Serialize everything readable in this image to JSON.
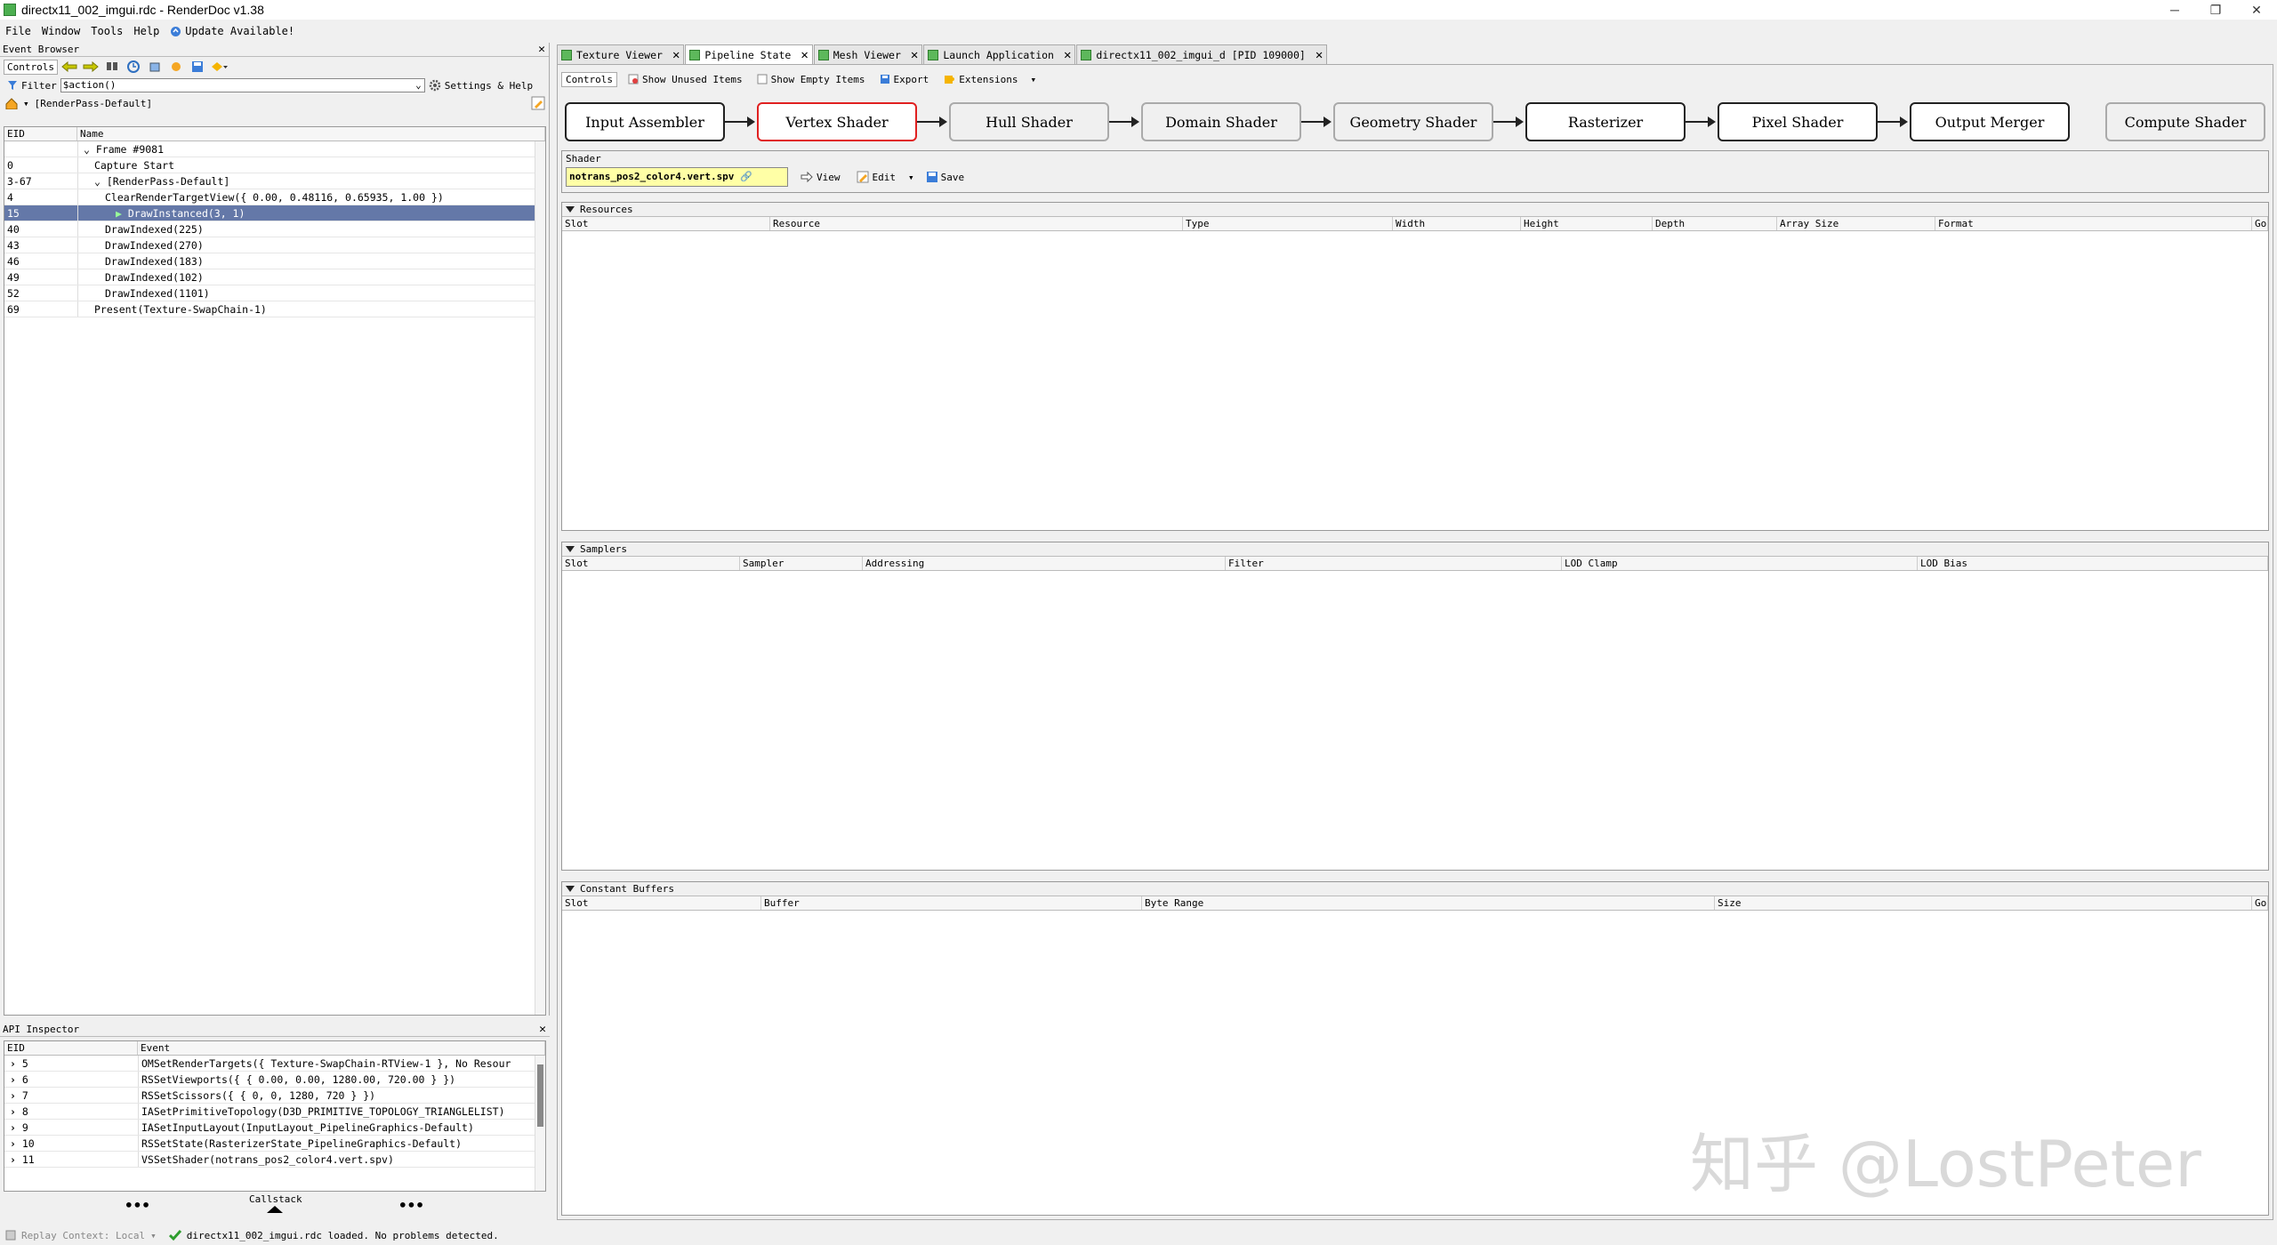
{
  "window": {
    "title": "directx11_002_imgui.rdc - RenderDoc v1.38",
    "min": "─",
    "restore": "❐",
    "close": "✕"
  },
  "menu": {
    "file": "File",
    "window": "Window",
    "tools": "Tools",
    "help": "Help",
    "update": "Update Available!"
  },
  "event_browser": {
    "title": "Event Browser",
    "controls_label": "Controls",
    "filter_label": "Filter",
    "filter_value": "$action()",
    "settings_label": "Settings & Help",
    "breadcrumb": "[RenderPass-Default]",
    "columns": [
      "EID",
      "Name"
    ],
    "rows": [
      {
        "eid": "",
        "name": "Frame #9081",
        "indent": 0,
        "expand": true
      },
      {
        "eid": "0",
        "name": "Capture Start",
        "indent": 1
      },
      {
        "eid": "3-67",
        "name": "[RenderPass-Default]",
        "indent": 1,
        "expand": true
      },
      {
        "eid": "4",
        "name": "ClearRenderTargetView({ 0.00, 0.48116, 0.65935, 1.00 })",
        "indent": 2
      },
      {
        "eid": "15",
        "name": "DrawInstanced(3, 1)",
        "indent": 3,
        "selected": true
      },
      {
        "eid": "40",
        "name": "DrawIndexed(225)",
        "indent": 2
      },
      {
        "eid": "43",
        "name": "DrawIndexed(270)",
        "indent": 2
      },
      {
        "eid": "46",
        "name": "DrawIndexed(183)",
        "indent": 2
      },
      {
        "eid": "49",
        "name": "DrawIndexed(102)",
        "indent": 2
      },
      {
        "eid": "52",
        "name": "DrawIndexed(1101)",
        "indent": 2
      },
      {
        "eid": "69",
        "name": "Present(Texture-SwapChain-1)",
        "indent": 1
      }
    ]
  },
  "api_inspector": {
    "title": "API Inspector",
    "columns": [
      "EID",
      "Event"
    ],
    "rows": [
      {
        "eid": "5",
        "event": "OMSetRenderTargets({  Texture-SwapChain-RTView-1  },  No Resour"
      },
      {
        "eid": "6",
        "event": "RSSetViewports({ { 0.00, 0.00, 1280.00, 720.00 } })"
      },
      {
        "eid": "7",
        "event": "RSSetScissors({ { 0, 0, 1280, 720 } })"
      },
      {
        "eid": "8",
        "event": "IASetPrimitiveTopology(D3D_PRIMITIVE_TOPOLOGY_TRIANGLELIST)"
      },
      {
        "eid": "9",
        "event": "IASetInputLayout(InputLayout_PipelineGraphics-Default)"
      },
      {
        "eid": "10",
        "event": "RSSetState(RasterizerState_PipelineGraphics-Default)"
      },
      {
        "eid": "11",
        "event": "VSSetShader(notrans_pos2_color4.vert.spv)"
      }
    ],
    "callstack": "Callstack",
    "dots": "•••"
  },
  "tabs": [
    {
      "label": "Texture Viewer",
      "active": false
    },
    {
      "label": "Pipeline State",
      "active": true
    },
    {
      "label": "Mesh Viewer",
      "active": false
    },
    {
      "label": "Launch Application",
      "active": false
    },
    {
      "label": "directx11_002_imgui_d [PID 109000]",
      "active": false
    }
  ],
  "pipeline": {
    "controls_label": "Controls",
    "show_unused": "Show Unused Items",
    "show_empty": "Show Empty Items",
    "export": "Export",
    "extensions": "Extensions",
    "stages": [
      "Input Assembler",
      "Vertex Shader",
      "Hull Shader",
      "Domain Shader",
      "Geometry Shader",
      "Rasterizer",
      "Pixel Shader",
      "Output Merger",
      "Compute Shader"
    ],
    "shader_label": "Shader",
    "shader_name": "notrans_pos2_color4.vert.spv",
    "view": "View",
    "edit": "Edit",
    "save": "Save",
    "resources": {
      "title": "Resources",
      "columns": [
        "Slot",
        "Resource",
        "Type",
        "Width",
        "Height",
        "Depth",
        "Array Size",
        "Format",
        "Go"
      ]
    },
    "samplers": {
      "title": "Samplers",
      "columns": [
        "Slot",
        "Sampler",
        "Addressing",
        "Filter",
        "LOD Clamp",
        "LOD Bias"
      ]
    },
    "constant_buffers": {
      "title": "Constant Buffers",
      "columns": [
        "Slot",
        "Buffer",
        "Byte Range",
        "Size",
        "Go"
      ]
    }
  },
  "status": {
    "replay": "Replay Context: Local",
    "message": "directx11_002_imgui.rdc loaded. No problems detected."
  },
  "watermark": "知乎 @LostPeter",
  "colors": {
    "selected_row": "#6478a8",
    "selected_stage": "#e02020",
    "accent_green": "#5db85b"
  }
}
